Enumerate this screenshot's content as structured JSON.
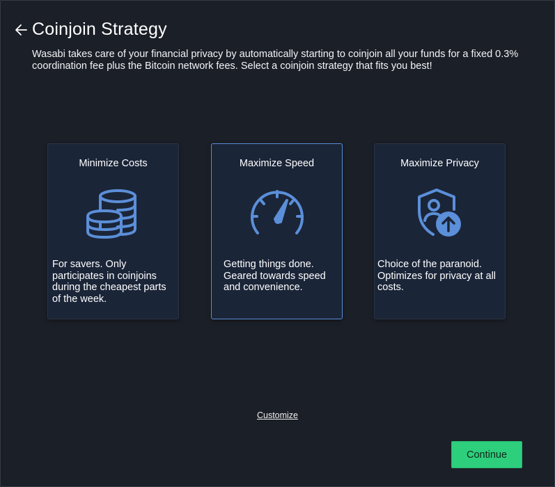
{
  "header": {
    "back_icon": "arrow-left-icon",
    "title": "Coinjoin Strategy",
    "description": "Wasabi takes care of your financial privacy by automatically starting to coinjoin all your funds for a fixed 0.3% coordination fee plus the Bitcoin network fees. Select a coinjoin strategy that fits you best!"
  },
  "strategies": [
    {
      "title": "Minimize Costs",
      "icon": "coin-stack-icon",
      "text": "For savers. Only participates in coinjoins during the cheapest parts of the week.",
      "selected": false
    },
    {
      "title": "Maximize Speed",
      "icon": "speedometer-icon",
      "text": "Getting things done. Geared towards speed and convenience.",
      "selected": true
    },
    {
      "title": "Maximize Privacy",
      "icon": "shield-user-icon",
      "text": "Choice of the paranoid. Optimizes for privacy at all costs.",
      "selected": false
    }
  ],
  "customize_label": "Customize",
  "continue_label": "Continue",
  "colors": {
    "background": "#1b1f27",
    "card": "#1b2538",
    "icon": "#5b8fd9",
    "selected_border": "#5b8fd9",
    "continue": "#2ecf7c"
  }
}
